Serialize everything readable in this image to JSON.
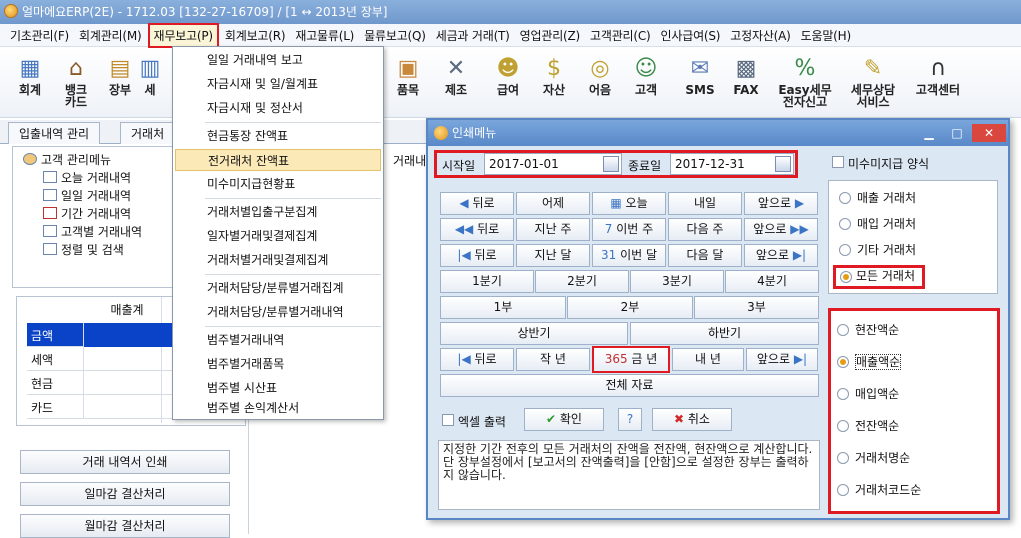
{
  "window": {
    "title": "얼마에요ERP(2E) - 1712.03 [132-27-16709] / [1 ↔ 2013년 장부]"
  },
  "menubar": [
    "기초관리(F)",
    "회계관리(M)",
    "재무보고(P)",
    "회계보고(R)",
    "재고물류(L)",
    "물류보고(Q)",
    "세금과 거래(T)",
    "영업관리(Z)",
    "고객관리(C)",
    "인사급여(S)",
    "고정자산(A)",
    "도움말(H)"
  ],
  "toolbar": {
    "left": [
      {
        "label": "회계",
        "icon": "ledger-icon"
      },
      {
        "label": "뱅크\n카드",
        "icon": "bank-icon"
      },
      {
        "label": "장부",
        "icon": "book-icon"
      },
      {
        "label": "세",
        "icon": "tax-icon"
      }
    ],
    "right": [
      {
        "label": "품목",
        "icon": "box-icon"
      },
      {
        "label": "제조",
        "icon": "tools-icon"
      },
      {
        "label": "급여",
        "icon": "salary-icon"
      },
      {
        "label": "자산",
        "icon": "asset-icon"
      },
      {
        "label": "어음",
        "icon": "note-icon"
      },
      {
        "label": "고객",
        "icon": "customer-icon"
      },
      {
        "label": "SMS",
        "icon": "sms-icon"
      },
      {
        "label": "FAX",
        "icon": "fax-icon"
      },
      {
        "label": "Easy세무\n전자신고",
        "icon": "easy-tax-icon"
      },
      {
        "label": "세무상담\n서비스",
        "icon": "consult-icon"
      },
      {
        "label": "고객센터",
        "icon": "headset-icon"
      }
    ]
  },
  "tabs": [
    "입출내역 관리",
    "거래처 "
  ],
  "tree": {
    "root": "고객 관리메뉴",
    "items": [
      "오늘 거래내역",
      "일일 거래내역",
      "기간 거래내역",
      "고객별 거래내역",
      "정렬 및 검색"
    ]
  },
  "summary": {
    "header": "매출계",
    "rows": [
      "금액",
      "세액",
      "현금",
      "카드"
    ]
  },
  "left_buttons": [
    "거래 내역서 인쇄",
    "일마감 결산처리",
    "월마감 결산처리"
  ],
  "behind_text": "거래내",
  "dropdown": {
    "items": [
      "일일 거래내역 보고",
      "자금시재 및 일/월계표",
      "자금시재 및 정산서",
      "현금통장 잔액표",
      "전거래처 잔액표",
      "미수미지급현황표",
      "거래처별입출구분집계",
      "일자별거래및결제집계",
      "거래처별거래및결제집계",
      "거래처담당/분류별거래집계",
      "거래처담당/분류별거래내역",
      "범주별거래내역",
      "범주별거래품목",
      "범주별 시산표",
      "범주별 손익계산서"
    ],
    "selected": "전거래처 잔액표"
  },
  "dialog": {
    "title": "인쇄메뉴",
    "start_label": "시작일",
    "start_value": "2017-01-01",
    "end_label": "종료일",
    "end_value": "2017-12-31",
    "unpaid_label": "미수미지급 양식",
    "row_day": [
      "뒤로",
      "어제",
      "오늘",
      "내일",
      "앞으로"
    ],
    "row_week": [
      "뒤로",
      "지난 주",
      "이번 주",
      "다음 주",
      "앞으로"
    ],
    "row_month": [
      "뒤로",
      "지난 달",
      "이번 달",
      "다음 달",
      "앞으로"
    ],
    "quarters": [
      "1분기",
      "2분기",
      "3분기",
      "4분기"
    ],
    "terms": [
      "1부",
      "2부",
      "3부"
    ],
    "halves": [
      "상반기",
      "하반기"
    ],
    "row_year": [
      "뒤로",
      "작 년",
      "금 년",
      "내 년",
      "앞으로"
    ],
    "all": "전체 자료",
    "excel": "엑셀 출력",
    "ok": "확인",
    "cancel": "취소",
    "type_options": [
      "매출 거래처",
      "매입 거래처",
      "기타 거래처",
      "모든 거래처"
    ],
    "type_selected": "모든 거래처",
    "sort_options": [
      "현잔액순",
      "매출액순",
      "매입액순",
      "전잔액순",
      "거래처명순",
      "거래처코드순"
    ],
    "sort_selected": "매출액순",
    "description": "지정한 기간 전후의 모든 거래처의 잔액을 전잔액, 현잔액으로 계산합니다.\n단 장부설정에서 [보고서의 잔액출력]을 [안함]으로 설정한 장부는 출력하지 않습니다."
  }
}
